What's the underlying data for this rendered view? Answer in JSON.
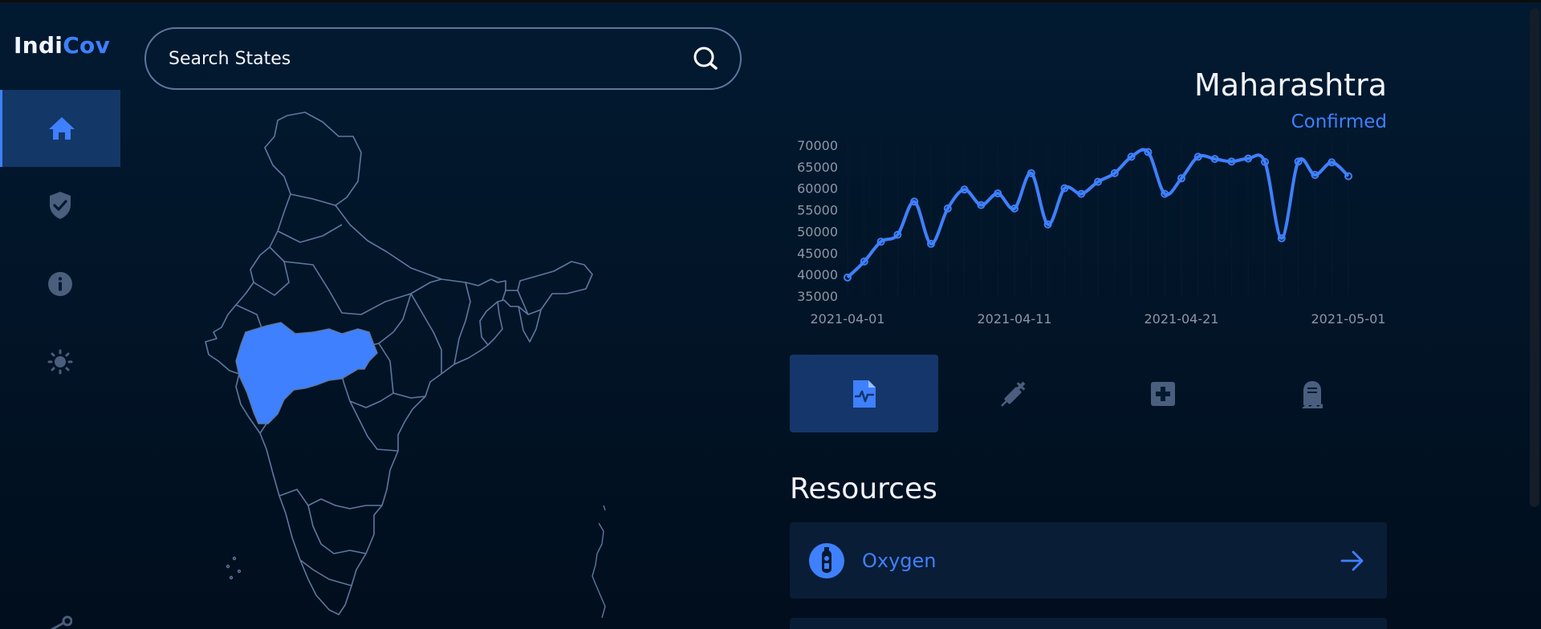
{
  "app": {
    "logo_part1": "Indi",
    "logo_part2": "Cov"
  },
  "sidebar": {
    "items": [
      {
        "name": "home",
        "icon": "home-icon",
        "active": true
      },
      {
        "name": "vaccine-shield",
        "icon": "shield-check-icon",
        "active": false
      },
      {
        "name": "info",
        "icon": "info-icon",
        "active": false
      },
      {
        "name": "theme",
        "icon": "sun-icon",
        "active": false
      },
      {
        "name": "share",
        "icon": "share-icon",
        "active": false
      }
    ]
  },
  "search": {
    "placeholder": "Search States"
  },
  "map": {
    "highlighted_state": "Maharashtra",
    "highlight_color": "#3f80ff"
  },
  "state_panel": {
    "state_name": "Maharashtra",
    "metric": "Confirmed"
  },
  "chart_data": {
    "type": "line",
    "title": "",
    "xlabel": "",
    "ylabel": "",
    "ylim": [
      35000,
      70000
    ],
    "y_ticks": [
      "70000",
      "65000",
      "60000",
      "55000",
      "50000",
      "45000",
      "40000",
      "35000"
    ],
    "x_ticks": [
      "2021-04-01",
      "2021-04-11",
      "2021-04-21",
      "2021-05-01"
    ],
    "x_start": "2021-04-01",
    "x": [
      "2021-04-01",
      "2021-04-02",
      "2021-04-03",
      "2021-04-04",
      "2021-04-05",
      "2021-04-06",
      "2021-04-07",
      "2021-04-08",
      "2021-04-09",
      "2021-04-10",
      "2021-04-11",
      "2021-04-12",
      "2021-04-13",
      "2021-04-14",
      "2021-04-15",
      "2021-04-16",
      "2021-04-17",
      "2021-04-18",
      "2021-04-19",
      "2021-04-20",
      "2021-04-21",
      "2021-04-22",
      "2021-04-23",
      "2021-04-24",
      "2021-04-25",
      "2021-04-26",
      "2021-04-27",
      "2021-04-28",
      "2021-04-29",
      "2021-04-30",
      "2021-05-01"
    ],
    "series": [
      {
        "values": [
          39500,
          43200,
          47800,
          49400,
          57100,
          47300,
          55500,
          59900,
          56300,
          59000,
          55500,
          63700,
          51800,
          60200,
          58900,
          61700,
          63700,
          67500,
          68600,
          58900,
          62500,
          67500,
          67000,
          66400,
          67100,
          66300,
          48600,
          66400,
          63300,
          66200,
          63000
        ],
        "color": "#3f80ff"
      }
    ],
    "grid": true
  },
  "tabs": [
    {
      "name": "tab-cases",
      "icon": "medical-report-icon",
      "active": true
    },
    {
      "name": "tab-vaccination",
      "icon": "syringe-icon",
      "active": false
    },
    {
      "name": "tab-hospitals",
      "icon": "medical-kit-icon",
      "active": false
    },
    {
      "name": "tab-deaths",
      "icon": "tombstone-icon",
      "active": false
    }
  ],
  "resources": {
    "title": "Resources",
    "items": [
      {
        "label": "Oxygen",
        "icon": "oxygen-cylinder-icon",
        "action_icon": "arrow-right-icon"
      }
    ]
  },
  "colors": {
    "accent": "#3f80ff",
    "background": "#011427",
    "panel": "#0a1d36",
    "active_nav": "#133766",
    "border": "#5d78a0"
  }
}
